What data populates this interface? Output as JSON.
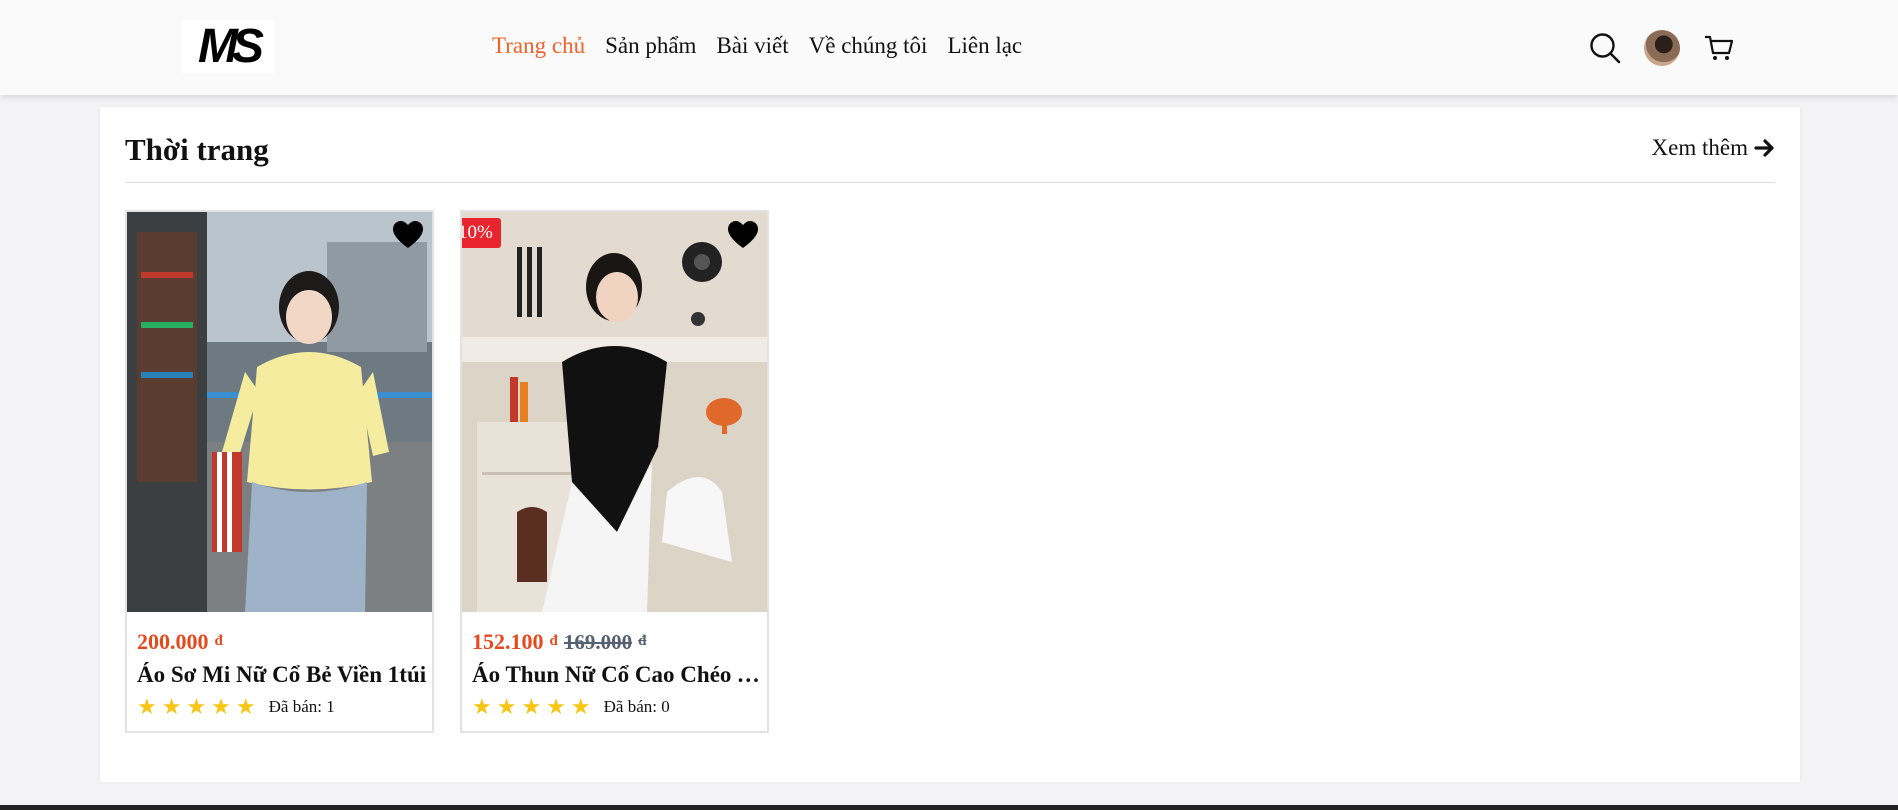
{
  "header": {
    "logo_text": "MS",
    "nav": [
      {
        "label": "Trang chủ",
        "active": true
      },
      {
        "label": "Sản phẩm",
        "active": false
      },
      {
        "label": "Bài viết",
        "active": false
      },
      {
        "label": "Về chúng tôi",
        "active": false
      },
      {
        "label": "Liên lạc",
        "active": false
      }
    ],
    "icons": [
      "search-icon",
      "avatar",
      "cart-icon"
    ]
  },
  "section": {
    "title": "Thời trang",
    "see_more": "Xem thêm"
  },
  "products": [
    {
      "price": "200.000",
      "currency": "đ",
      "name": "Áo Sơ Mi Nữ Cổ Bẻ Viền 1túi",
      "stars": 5,
      "stars_text": "★★★★★",
      "sold": "Đã bán: 1"
    },
    {
      "badge": "10%",
      "price": "152.100",
      "currency": "đ",
      "old_price": "169.000",
      "old_currency": "đ",
      "name": "Áo Thun Nữ Cổ Cao Chéo Vạt",
      "stars": 5,
      "stars_text": "★★★★★",
      "sold": "Đã bán: 0"
    }
  ],
  "colors": {
    "accent": "#f1612a",
    "price": "#e54a1f",
    "badge": "#e8252f",
    "star": "#f7c615"
  }
}
